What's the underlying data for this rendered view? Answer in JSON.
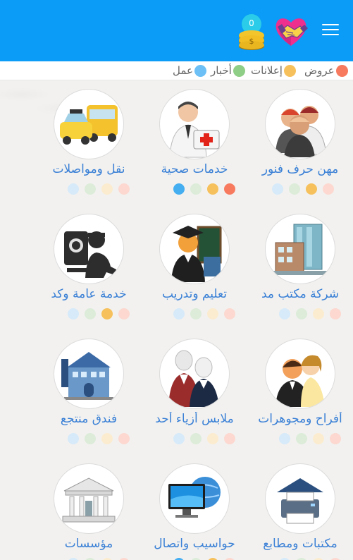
{
  "header": {
    "coin_count": "0",
    "logo_icon": "handshake-icon",
    "menu_icon": "menu-icon"
  },
  "legend": [
    {
      "label": "عروض",
      "color": "#f77a5e"
    },
    {
      "label": "إعلانات",
      "color": "#f6c15c"
    },
    {
      "label": "أخبار",
      "color": "#8fce86"
    },
    {
      "label": "عمل",
      "color": "#6cc0f5"
    }
  ],
  "categories": [
    {
      "label": "مهن حرف فنور",
      "icon": "craftsmen-icon",
      "dots": {
        "red": false,
        "yellow": true,
        "green": false,
        "blue": false
      }
    },
    {
      "label": "خدمات صحية",
      "icon": "doctor-icon",
      "dots": {
        "red": true,
        "yellow": true,
        "green": false,
        "blue": true
      }
    },
    {
      "label": "نقل ومواصلات",
      "icon": "taxi-icon",
      "dots": {
        "red": false,
        "yellow": false,
        "green": false,
        "blue": false
      }
    },
    {
      "label": "شركة مكتب مد",
      "icon": "office-building-icon",
      "dots": {
        "red": false,
        "yellow": false,
        "green": false,
        "blue": false
      }
    },
    {
      "label": "تعليم وتدريب",
      "icon": "graduate-icon",
      "dots": {
        "red": false,
        "yellow": false,
        "green": false,
        "blue": false
      }
    },
    {
      "label": "خدمة عامة وكد",
      "icon": "repair-service-icon",
      "dots": {
        "red": false,
        "yellow": true,
        "green": false,
        "blue": false
      }
    },
    {
      "label": "أفراح ومجوهرات",
      "icon": "wedding-couple-icon",
      "dots": {
        "red": false,
        "yellow": false,
        "green": false,
        "blue": false
      }
    },
    {
      "label": "ملابس أزياء أحد",
      "icon": "fashion-icon",
      "dots": {
        "red": false,
        "yellow": false,
        "green": false,
        "blue": false
      }
    },
    {
      "label": "فندق منتجع",
      "icon": "hotel-icon",
      "dots": {
        "red": false,
        "yellow": false,
        "green": false,
        "blue": false
      }
    },
    {
      "label": "مكتبات ومطابع",
      "icon": "printer-icon",
      "dots": {
        "red": false,
        "yellow": false,
        "green": false,
        "blue": false
      }
    },
    {
      "label": "حواسيب واتصال",
      "icon": "computer-icon",
      "dots": {
        "red": false,
        "yellow": true,
        "green": false,
        "blue": true
      }
    },
    {
      "label": "مؤسسات",
      "icon": "institution-icon",
      "dots": {
        "red": false,
        "yellow": false,
        "green": false,
        "blue": false
      }
    }
  ]
}
